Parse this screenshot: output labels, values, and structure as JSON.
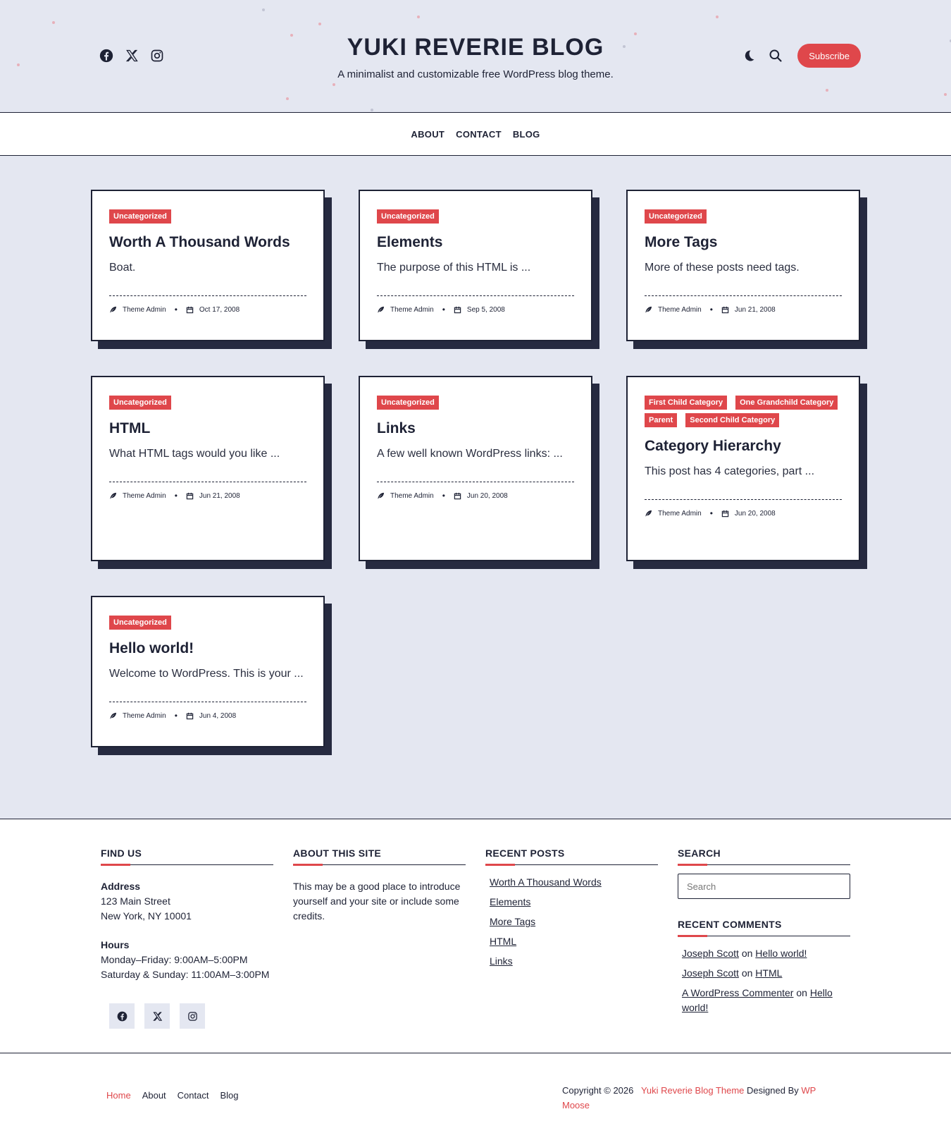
{
  "colors": {
    "accent": "#df474b",
    "dark": "#1e2235",
    "background": "#e4e7f1",
    "card": "#ffffff"
  },
  "header": {
    "title": "YUKI REVERIE BLOG",
    "tagline": "A minimalist and customizable free WordPress blog theme.",
    "subscribe_label": "Subscribe",
    "social_icons": [
      "facebook-icon",
      "x-icon",
      "instagram-icon"
    ],
    "action_icons": [
      "moon-icon",
      "search-icon"
    ]
  },
  "nav": {
    "items": [
      "ABOUT",
      "CONTACT",
      "BLOG"
    ]
  },
  "posts": [
    {
      "categories": [
        "Uncategorized"
      ],
      "title": "Worth A Thousand Words",
      "excerpt": "Boat.",
      "author": "Theme Admin",
      "date": "Oct 17, 2008"
    },
    {
      "categories": [
        "Uncategorized"
      ],
      "title": "Elements",
      "excerpt": "The purpose of this HTML is ...",
      "author": "Theme Admin",
      "date": "Sep 5, 2008"
    },
    {
      "categories": [
        "Uncategorized"
      ],
      "title": "More Tags",
      "excerpt": "More of these posts need tags.",
      "author": "Theme Admin",
      "date": "Jun 21, 2008"
    },
    {
      "categories": [
        "Uncategorized"
      ],
      "title": "HTML",
      "excerpt": "What HTML tags would you like ...",
      "author": "Theme Admin",
      "date": "Jun 21, 2008"
    },
    {
      "categories": [
        "Uncategorized"
      ],
      "title": "Links",
      "excerpt": "A few well known WordPress links: ...",
      "author": "Theme Admin",
      "date": "Jun 20, 2008"
    },
    {
      "categories": [
        "First Child Category",
        "One Grandchild Category",
        "Parent",
        "Second Child Category"
      ],
      "title": "Category Hierarchy",
      "excerpt": "This post has 4 categories, part ...",
      "author": "Theme Admin",
      "date": "Jun 20, 2008"
    },
    {
      "categories": [
        "Uncategorized"
      ],
      "title": "Hello world!",
      "excerpt": "Welcome to WordPress. This is your ...",
      "author": "Theme Admin",
      "date": "Jun 4, 2008"
    }
  ],
  "footer": {
    "find_us": {
      "heading": "FIND US",
      "address_label": "Address",
      "address_line1": "123 Main Street",
      "address_line2": "New York, NY 10001",
      "hours_label": "Hours",
      "hours_line1": "Monday–Friday: 9:00AM–5:00PM",
      "hours_line2": "Saturday & Sunday: 11:00AM–3:00PM"
    },
    "about": {
      "heading": "ABOUT THIS SITE",
      "text": "This may be a good place to introduce yourself and your site or include some credits."
    },
    "recent_posts": {
      "heading": "RECENT POSTS",
      "items": [
        "Worth A Thousand Words",
        "Elements",
        "More Tags",
        "HTML",
        "Links"
      ]
    },
    "search": {
      "heading": "SEARCH",
      "placeholder": "Search"
    },
    "recent_comments": {
      "heading": "RECENT COMMENTS",
      "items": [
        {
          "author": "Joseph Scott",
          "on": "on",
          "post": "Hello world!"
        },
        {
          "author": "Joseph Scott",
          "on": "on",
          "post": "HTML"
        },
        {
          "author": "A WordPress Commenter",
          "on": "on",
          "post": "Hello world!"
        }
      ]
    }
  },
  "bottom_footer": {
    "nav": [
      "Home",
      "About",
      "Contact",
      "Blog"
    ],
    "copyright_prefix": "Copyright © 2026",
    "theme_link": "Yuki Reverie Blog Theme",
    "designed_by": "Designed By",
    "designer_link": "WP Moose"
  }
}
